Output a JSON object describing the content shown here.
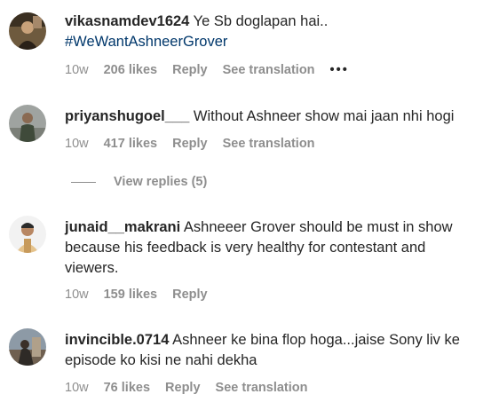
{
  "comments": [
    {
      "username": "vikasnamdev1624",
      "text": "Ye Sb doglapan hai..",
      "hashtag": "#WeWantAshneerGrover",
      "time": "10w",
      "likes": "206 likes",
      "reply": "Reply",
      "translate": "See translation",
      "more": "•••"
    },
    {
      "username": "priyanshugoel___",
      "text": "Without Ashneer show mai jaan nhi hogi",
      "time": "10w",
      "likes": "417 likes",
      "reply": "Reply",
      "translate": "See translation",
      "view_replies": "View replies (5)"
    },
    {
      "username": "junaid__makrani",
      "text": "Ashneeer Grover should be must in show because his feedback is very healthy for contestant and viewers.",
      "time": "10w",
      "likes": "159 likes",
      "reply": "Reply"
    },
    {
      "username": "invincible.0714",
      "text": "Ashneer ke bina flop hoga...jaise Sony liv ke episode ko kisi ne nahi dekha",
      "time": "10w",
      "likes": "76 likes",
      "reply": "Reply",
      "translate": "See translation"
    }
  ],
  "colors": {
    "text": "#262626",
    "secondary": "#8e8e8e",
    "hashtag": "#00376b"
  }
}
